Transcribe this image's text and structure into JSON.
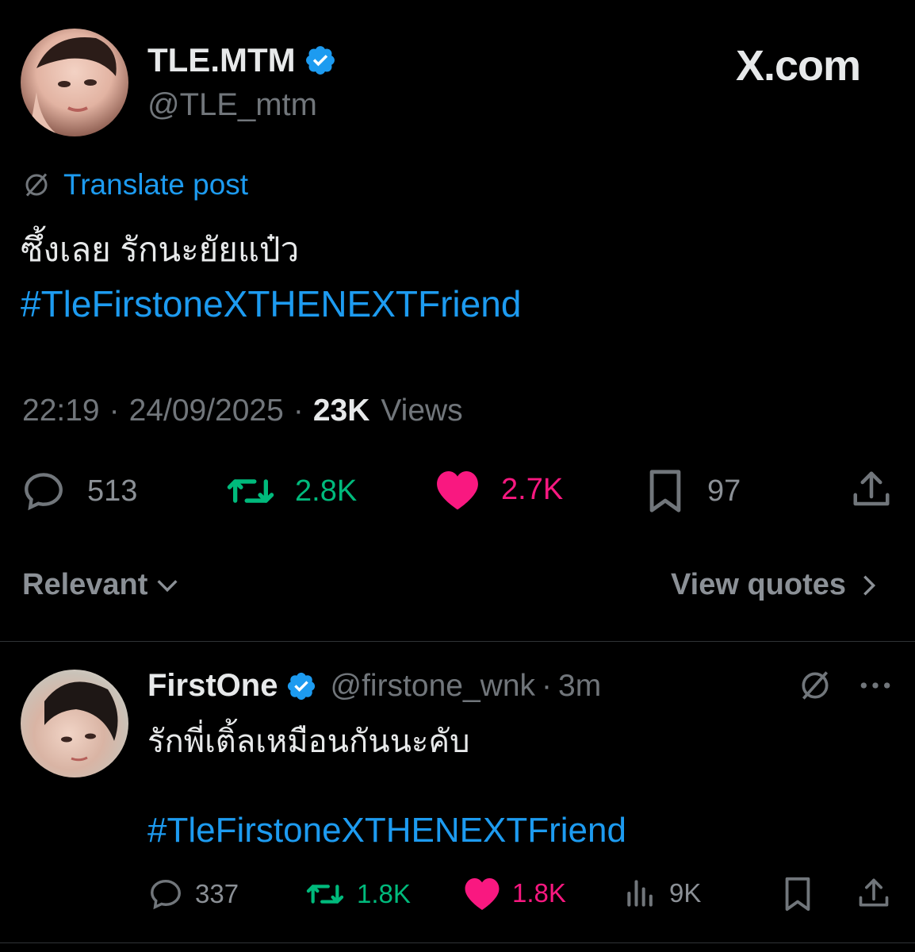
{
  "post": {
    "display_name": "TLE.MTM",
    "handle": "@TLE_mtm",
    "brand": "X.com",
    "translate_label": "Translate post",
    "text": "ซึ้งเลย รักนะยัยแป๋ว",
    "hashtag": "#TleFirstoneXTHENEXTFriend",
    "time": "22:19",
    "date": "24/09/2025",
    "views_count": "23K",
    "views_label": "Views",
    "replies": "513",
    "reposts": "2.8K",
    "likes": "2.7K",
    "bookmarks": "97"
  },
  "sort": {
    "label": "Relevant",
    "view_quotes": "View quotes"
  },
  "reply": {
    "display_name": "FirstOne",
    "handle": "@firstone_wnk",
    "age": "3m",
    "text": "รักพี่เติ้ลเหมือนกันนะคับ",
    "hashtag": "#TleFirstoneXTHENEXTFriend",
    "replies": "337",
    "reposts": "1.8K",
    "likes": "1.8K",
    "views": "9K"
  },
  "colors": {
    "background": "#000000",
    "text": "#e7e9ea",
    "muted": "#71767b",
    "link": "#1d9bf0",
    "repost": "#00ba7c",
    "like": "#f91880"
  },
  "icons": [
    "verified-badge-icon",
    "translate-icon",
    "reply-icon",
    "repost-icon",
    "heart-icon",
    "bookmark-icon",
    "share-icon",
    "chevron-down-icon",
    "chevron-right-icon",
    "grok-icon",
    "more-icon",
    "views-icon"
  ]
}
